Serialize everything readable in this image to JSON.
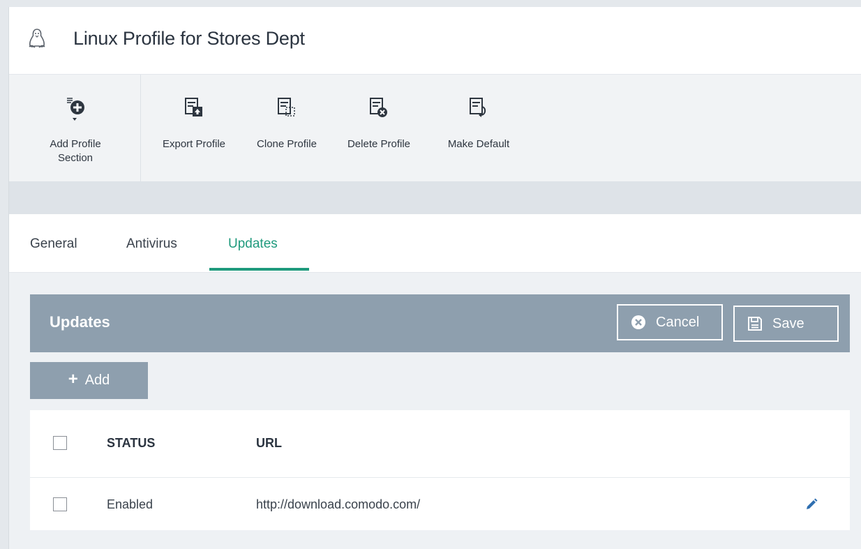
{
  "header": {
    "title": "Linux Profile for Stores Dept",
    "icon": "tux-icon"
  },
  "toolbar": {
    "add_section_line1": "Add Profile",
    "add_section_line2": "Section",
    "export": "Export Profile",
    "clone": "Clone Profile",
    "delete": "Delete Profile",
    "make_default": "Make Default"
  },
  "tabs": [
    {
      "label": "General"
    },
    {
      "label": "Antivirus"
    },
    {
      "label": "Updates"
    }
  ],
  "active_tab": "Updates",
  "panel": {
    "title": "Updates",
    "cancel_label": "Cancel",
    "save_label": "Save"
  },
  "add_button": {
    "label": "Add"
  },
  "table": {
    "columns": [
      "STATUS",
      "URL"
    ],
    "rows": [
      {
        "status": "Enabled",
        "url": "http://download.comodo.com/"
      }
    ]
  },
  "colors": {
    "accent": "#1f9a7d",
    "panel_header": "#8e9fae",
    "link_blue": "#2f6fb0"
  }
}
